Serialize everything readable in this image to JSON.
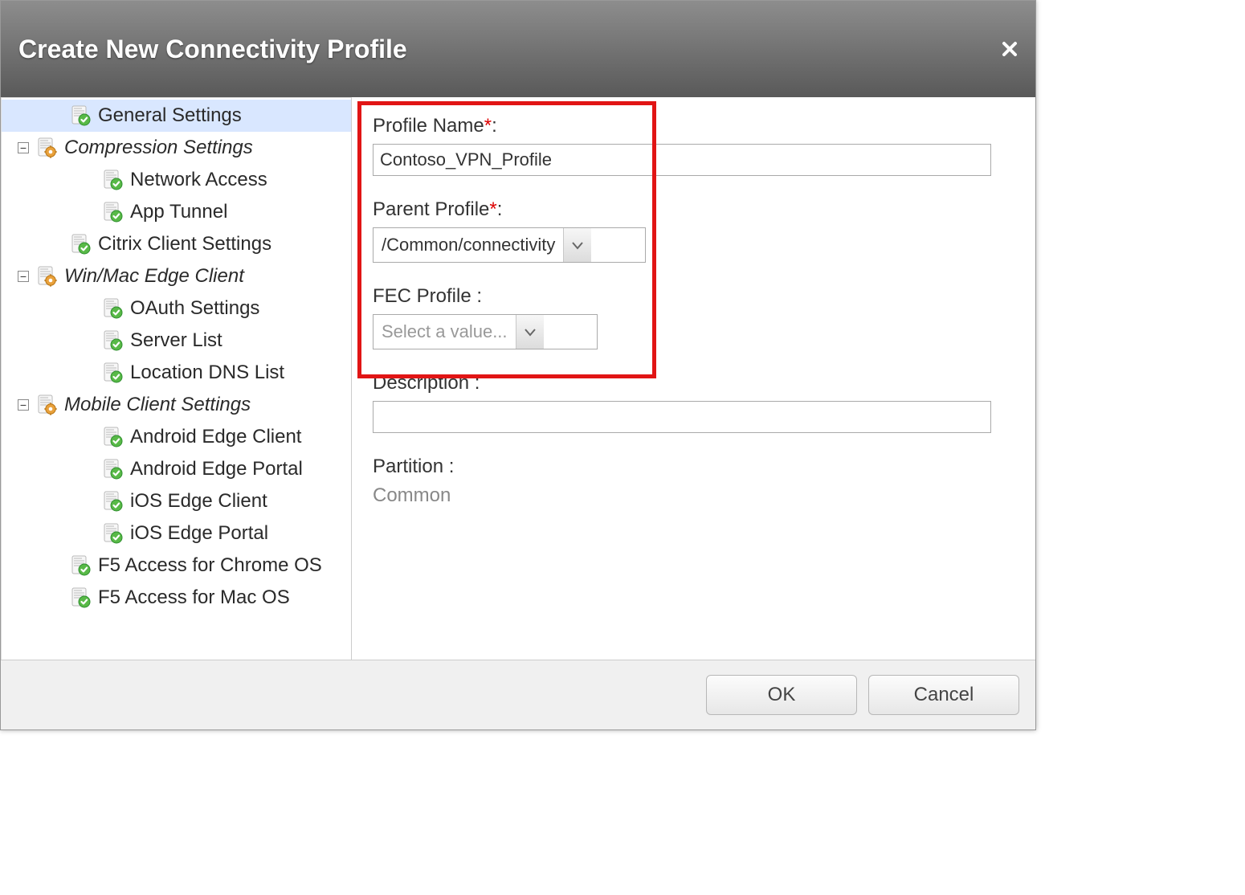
{
  "dialog": {
    "title": "Create New Connectivity Profile"
  },
  "sidebar": {
    "items": [
      {
        "label": "General Settings",
        "indent": 1,
        "expander": "",
        "icon": "page-check",
        "group": false,
        "selected": true
      },
      {
        "label": "Compression Settings",
        "indent": 0,
        "expander": "-",
        "icon": "page-gear",
        "group": true,
        "selected": false
      },
      {
        "label": "Network Access",
        "indent": 2,
        "expander": "",
        "icon": "page-check",
        "group": false,
        "selected": false
      },
      {
        "label": "App Tunnel",
        "indent": 2,
        "expander": "",
        "icon": "page-check",
        "group": false,
        "selected": false
      },
      {
        "label": "Citrix Client Settings",
        "indent": 1,
        "expander": "",
        "icon": "page-check",
        "group": false,
        "selected": false
      },
      {
        "label": "Win/Mac Edge Client",
        "indent": 0,
        "expander": "-",
        "icon": "page-gear",
        "group": true,
        "selected": false
      },
      {
        "label": "OAuth Settings",
        "indent": 2,
        "expander": "",
        "icon": "page-check",
        "group": false,
        "selected": false
      },
      {
        "label": "Server List",
        "indent": 2,
        "expander": "",
        "icon": "page-check",
        "group": false,
        "selected": false
      },
      {
        "label": "Location DNS List",
        "indent": 2,
        "expander": "",
        "icon": "page-check",
        "group": false,
        "selected": false
      },
      {
        "label": "Mobile Client Settings",
        "indent": 0,
        "expander": "-",
        "icon": "page-gear",
        "group": true,
        "selected": false
      },
      {
        "label": "Android Edge Client",
        "indent": 2,
        "expander": "",
        "icon": "page-check",
        "group": false,
        "selected": false
      },
      {
        "label": "Android Edge Portal",
        "indent": 2,
        "expander": "",
        "icon": "page-check",
        "group": false,
        "selected": false
      },
      {
        "label": "iOS Edge Client",
        "indent": 2,
        "expander": "",
        "icon": "page-check",
        "group": false,
        "selected": false
      },
      {
        "label": "iOS Edge Portal",
        "indent": 2,
        "expander": "",
        "icon": "page-check",
        "group": false,
        "selected": false
      },
      {
        "label": "F5 Access for Chrome OS",
        "indent": 1,
        "expander": "",
        "icon": "page-check",
        "group": false,
        "selected": false
      },
      {
        "label": "F5 Access for Mac OS",
        "indent": 1,
        "expander": "",
        "icon": "page-check",
        "group": false,
        "selected": false
      }
    ]
  },
  "form": {
    "profile_name": {
      "label": "Profile Name",
      "required": "*",
      "suffix": ":",
      "value": "Contoso_VPN_Profile"
    },
    "parent_profile": {
      "label": "Parent Profile",
      "required": "*",
      "suffix": ":",
      "value": "/Common/connectivity"
    },
    "fec_profile": {
      "label": "FEC Profile ",
      "suffix": ":",
      "placeholder": "Select a value..."
    },
    "description": {
      "label": "Description ",
      "suffix": ":",
      "value": ""
    },
    "partition": {
      "label": "Partition ",
      "suffix": ":",
      "value": "Common"
    }
  },
  "footer": {
    "ok": "OK",
    "cancel": "Cancel"
  }
}
